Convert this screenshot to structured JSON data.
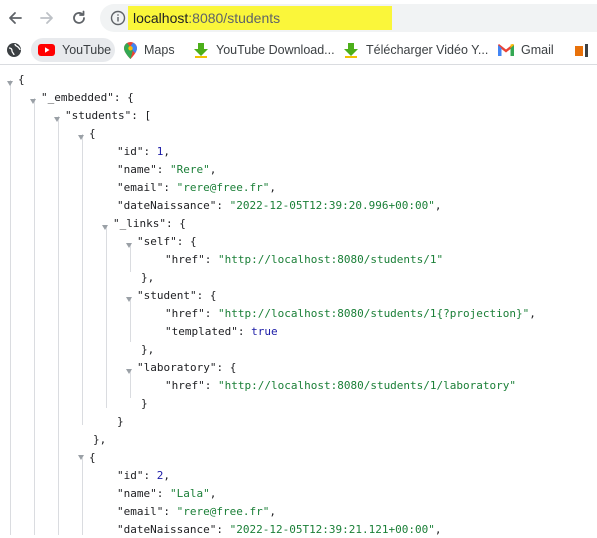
{
  "address_bar": {
    "host": "localhost",
    "rest": ":8080/students"
  },
  "bookmarks": [
    {
      "label": "YouTube",
      "icon": "youtube-icon"
    },
    {
      "label": "Maps",
      "icon": "maps-pin-icon"
    },
    {
      "label": "YouTube Download...",
      "icon": "download-arrow-icon"
    },
    {
      "label": "Télécharger Vidéo Y...",
      "icon": "download-arrow-icon"
    },
    {
      "label": "Gmail",
      "icon": "gmail-icon"
    }
  ],
  "json": {
    "open_brace": "{",
    "embedded_key": "\"_embedded\"",
    "students_key": "\"students\"",
    "student1": {
      "id_key": "\"id\"",
      "id_val": "1",
      "name_key": "\"name\"",
      "name_val": "\"Rere\"",
      "email_key": "\"email\"",
      "email_val": "\"rere@free.fr\"",
      "date_key": "\"dateNaissance\"",
      "date_val": "\"2022-12-05T12:39:20.996+00:00\"",
      "links_key": "\"_links\"",
      "self_key": "\"self\"",
      "self_href_key": "\"href\"",
      "self_href_val": "\"http://localhost:8080/students/1\"",
      "student_key": "\"student\"",
      "student_href_key": "\"href\"",
      "student_href_val": "\"http://localhost:8080/students/1{?projection}\"",
      "templated_key": "\"templated\"",
      "templated_val": "true",
      "lab_key": "\"laboratory\"",
      "lab_href_key": "\"href\"",
      "lab_href_val": "\"http://localhost:8080/students/1/laboratory\""
    },
    "student2": {
      "id_key": "\"id\"",
      "id_val": "2",
      "name_key": "\"name\"",
      "name_val": "\"Lala\"",
      "email_key": "\"email\"",
      "email_val": "\"rere@free.fr\"",
      "date_key": "\"dateNaissance\"",
      "date_val": "\"2022-12-05T12:39:21.121+00:00\""
    }
  }
}
